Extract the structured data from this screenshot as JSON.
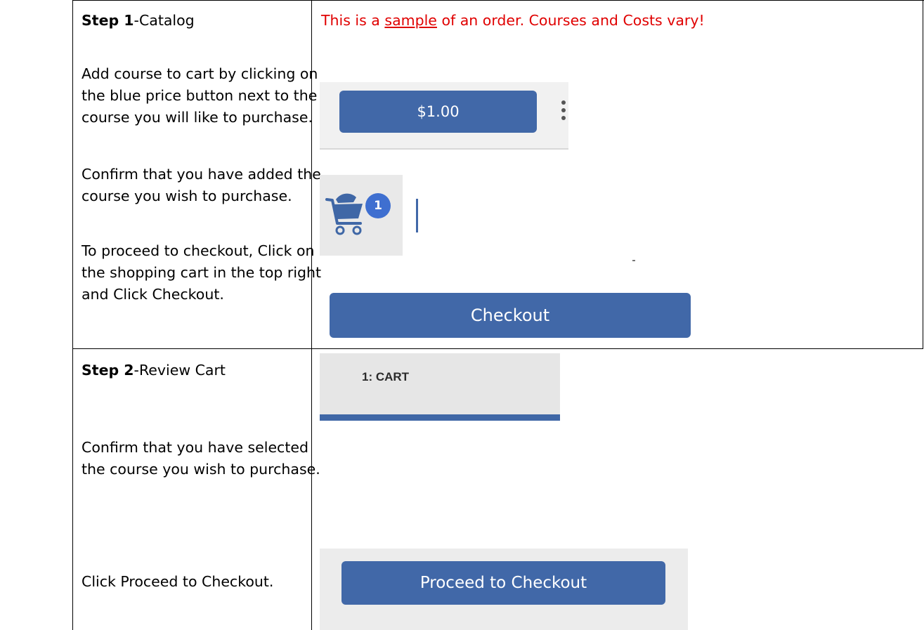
{
  "notice": {
    "before": "This is a ",
    "underlined": "sample",
    "after": " of an order. Courses and Costs vary!"
  },
  "step1": {
    "number": "Step 1",
    "name": "-Catalog",
    "para1": [
      "Add course to cart by clicking on",
      "the blue price button next to the",
      "course you will like to purchase."
    ],
    "para2": [
      "Confirm that you have added the",
      "course you wish to purchase."
    ],
    "para3": [
      "To proceed to checkout, Click on",
      "the shopping cart in the top right",
      "and Click Checkout."
    ],
    "price_button": "$1.00",
    "cart_badge_count": "1",
    "checkout_button": "Checkout"
  },
  "step2": {
    "number": "Step 2",
    "name": "-Review Cart",
    "para1": [
      "Confirm that you have selected",
      "the course you wish to purchase."
    ],
    "para2": "Click Proceed to Checkout.",
    "cart_tab_label": "1: CART",
    "proceed_button": "Proceed to Checkout"
  },
  "colors": {
    "button_blue": "#4168a8",
    "badge_blue": "#3f6fd0",
    "notice_red": "#e00000",
    "panel_gray": "#f1f1f1"
  },
  "icons": [
    "shopping-cart-icon",
    "more-vertical-icon"
  ]
}
